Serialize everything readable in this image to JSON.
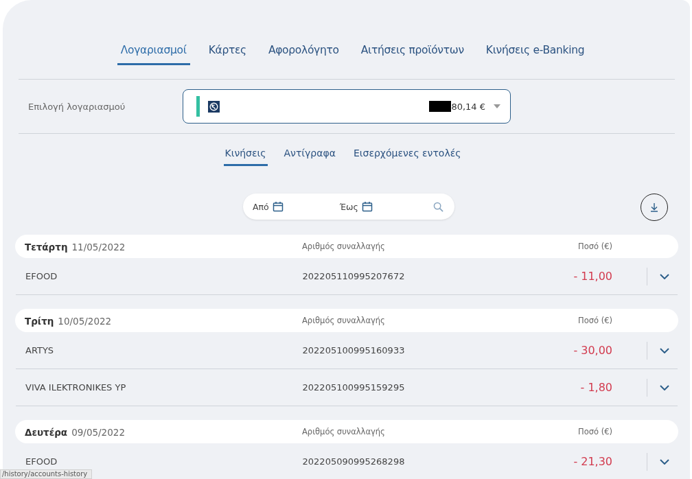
{
  "main_tabs": [
    {
      "label": "Λογαριασμοί",
      "selected": true
    },
    {
      "label": "Κάρτες",
      "selected": false
    },
    {
      "label": "Αφορολόγητο",
      "selected": false
    },
    {
      "label": "Αιτήσεις προϊόντων",
      "selected": false
    },
    {
      "label": "Κινήσεις e-Banking",
      "selected": false
    }
  ],
  "account_select": {
    "label": "Επιλογή λογαριασμού",
    "balance": "80,14 €"
  },
  "sub_tabs": [
    {
      "label": "Κινήσεις",
      "selected": true
    },
    {
      "label": "Αντίγραφα",
      "selected": false
    },
    {
      "label": "Εισερχόμενες εντολές",
      "selected": false
    }
  ],
  "filter": {
    "from": "Από",
    "to": "Έως"
  },
  "days": [
    {
      "weekday": "Τετάρτη",
      "date": "11/05/2022",
      "number_header": "Αριθμός συναλλαγής",
      "amount_header": "Ποσό (€)",
      "rows": [
        {
          "name": "EFOOD",
          "number": "202205110995207672",
          "amount": "- 11,00"
        }
      ]
    },
    {
      "weekday": "Τρίτη",
      "date": "10/05/2022",
      "number_header": "Αριθμός συναλλαγής",
      "amount_header": "Ποσό (€)",
      "rows": [
        {
          "name": "ARTYS",
          "number": "202205100995160933",
          "amount": "- 30,00"
        },
        {
          "name": "VIVA ILEKTRONIKES YP",
          "number": "202205100995159295",
          "amount": "- 1,80"
        }
      ]
    },
    {
      "weekday": "Δευτέρα",
      "date": "09/05/2022",
      "number_header": "Αριθμός συναλλαγής",
      "amount_header": "Ποσό (€)",
      "rows": [
        {
          "name": "EFOOD",
          "number": "202205090995268298",
          "amount": "- 21,30"
        }
      ]
    }
  ],
  "status_url": "/history/accounts-history"
}
